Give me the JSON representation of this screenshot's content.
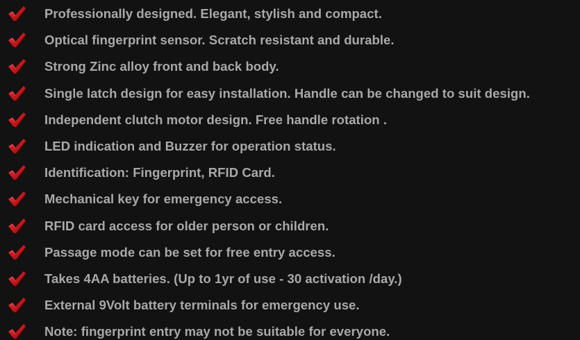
{
  "icon": {
    "name": "check-mark-icon",
    "color": "#c4161c",
    "shadow": "#5a0a0d"
  },
  "text_color": "#a9a9a9",
  "background": "#121212",
  "features": [
    "Professionally designed. Elegant, stylish and compact.",
    "Optical fingerprint sensor. Scratch resistant and durable.",
    "Strong Zinc alloy front and back body.",
    "Single latch design for easy installation. Handle can be changed to suit design.",
    "Independent clutch motor design. Free handle rotation .",
    "LED indication and Buzzer for operation status.",
    "Identification: Fingerprint, RFID Card.",
    "Mechanical key for emergency access.",
    "RFID card access for older person or children.",
    "Passage mode can be set for free entry access.",
    "Takes 4AA batteries. (Up to 1yr of use - 30 activation /day.)",
    "External 9Volt battery terminals for emergency use.",
    "Note: fingerprint entry may not be suitable for everyone."
  ]
}
